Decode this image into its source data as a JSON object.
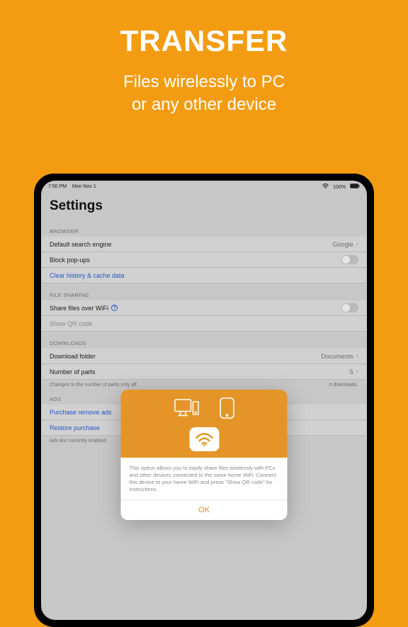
{
  "hero": {
    "title": "TRANSFER",
    "line1": "Files wirelessly to PC",
    "line2": "or any other device"
  },
  "status": {
    "time": "7:50 PM",
    "date": "Mon Nov 1",
    "battery": "100%"
  },
  "page_title": "Settings",
  "sections": {
    "browser": {
      "header": "BROWSER",
      "default_search_label": "Default search engine",
      "default_search_value": "Google",
      "block_popups_label": "Block pop-ups",
      "clear_data_label": "Clear history & cache data"
    },
    "file_sharing": {
      "header": "FILE SHARING",
      "share_wifi_label": "Share files over WiFi",
      "show_qr_label": "Show QR code"
    },
    "downloads": {
      "header": "DOWNLOADS",
      "folder_label": "Download folder",
      "folder_value": "Documents",
      "parts_label": "Number of parts",
      "parts_value": "5",
      "footnote_left": "Changes to the number of parts only aff",
      "footnote_right": "rt downloads."
    },
    "ads": {
      "header": "ADS",
      "purchase_label": "Purchase remove ads",
      "restore_label": "Restore purchase",
      "footnote": "Ads are currently enabled."
    }
  },
  "modal": {
    "body": "This option allows you to easily share files wirelessly with PCs and other devices connected to the same home WiFi. Connect this device to your home WiFi and press \"Show QR code\" for instructions.",
    "ok": "OK"
  }
}
